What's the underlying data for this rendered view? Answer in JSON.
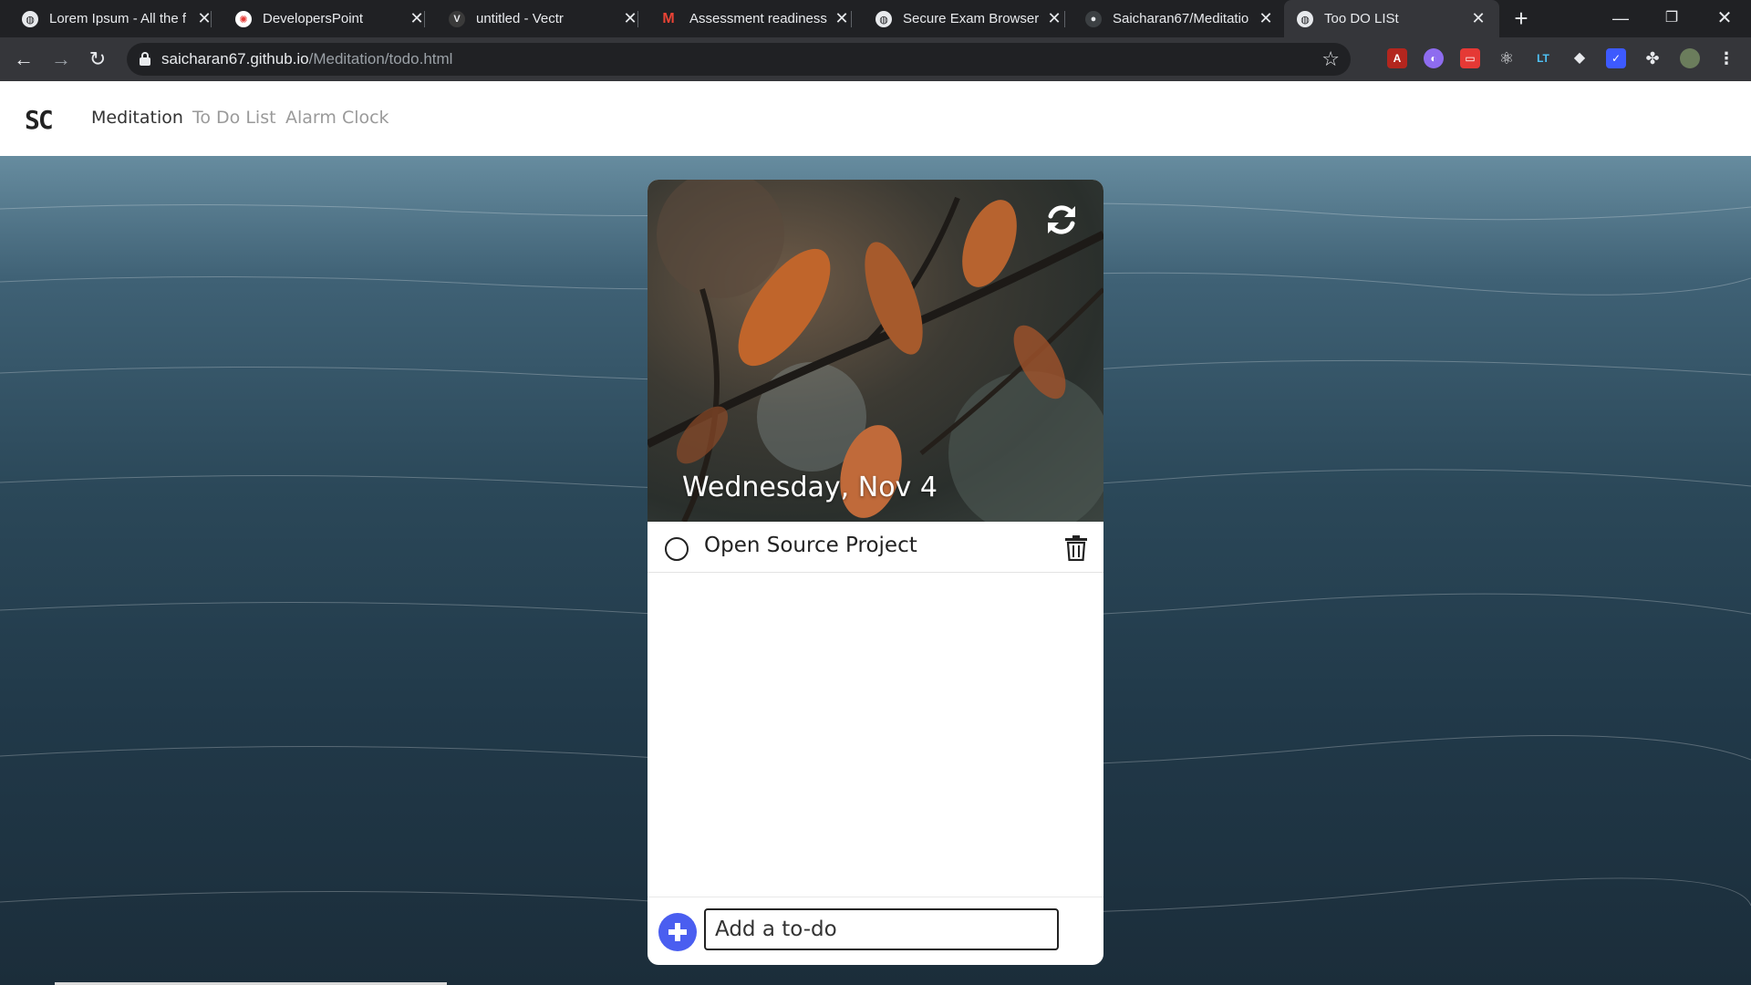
{
  "browser": {
    "tabs": [
      {
        "title": "Lorem Ipsum - All the f",
        "icon": "globe-icon"
      },
      {
        "title": "DevelopersPoint",
        "icon": "developerspoint-icon"
      },
      {
        "title": "untitled - Vectr",
        "icon": "vectr-icon"
      },
      {
        "title": "Assessment readiness",
        "icon": "gmail-icon"
      },
      {
        "title": "Secure Exam Browser",
        "icon": "globe-icon"
      },
      {
        "title": "Saicharan67/Meditatio",
        "icon": "github-icon"
      },
      {
        "title": "Too DO LISt",
        "icon": "globe-icon",
        "active": true
      }
    ],
    "url_host": "saicharan67.github.io",
    "url_path": "/Meditation/todo.html"
  },
  "site": {
    "brand": "SC",
    "nav": [
      {
        "label": "Meditation",
        "active": true
      },
      {
        "label": "To Do List",
        "active": false
      },
      {
        "label": "Alarm Clock",
        "active": false
      }
    ]
  },
  "todo": {
    "date": "Wednesday, Nov 4",
    "items": [
      {
        "text": "Open Source Project",
        "done": false
      }
    ],
    "add_placeholder": "Add a to-do"
  },
  "colors": {
    "accent": "#4a5ef0",
    "chrome_dark": "#202124",
    "chrome_toolbar": "#35363a"
  }
}
